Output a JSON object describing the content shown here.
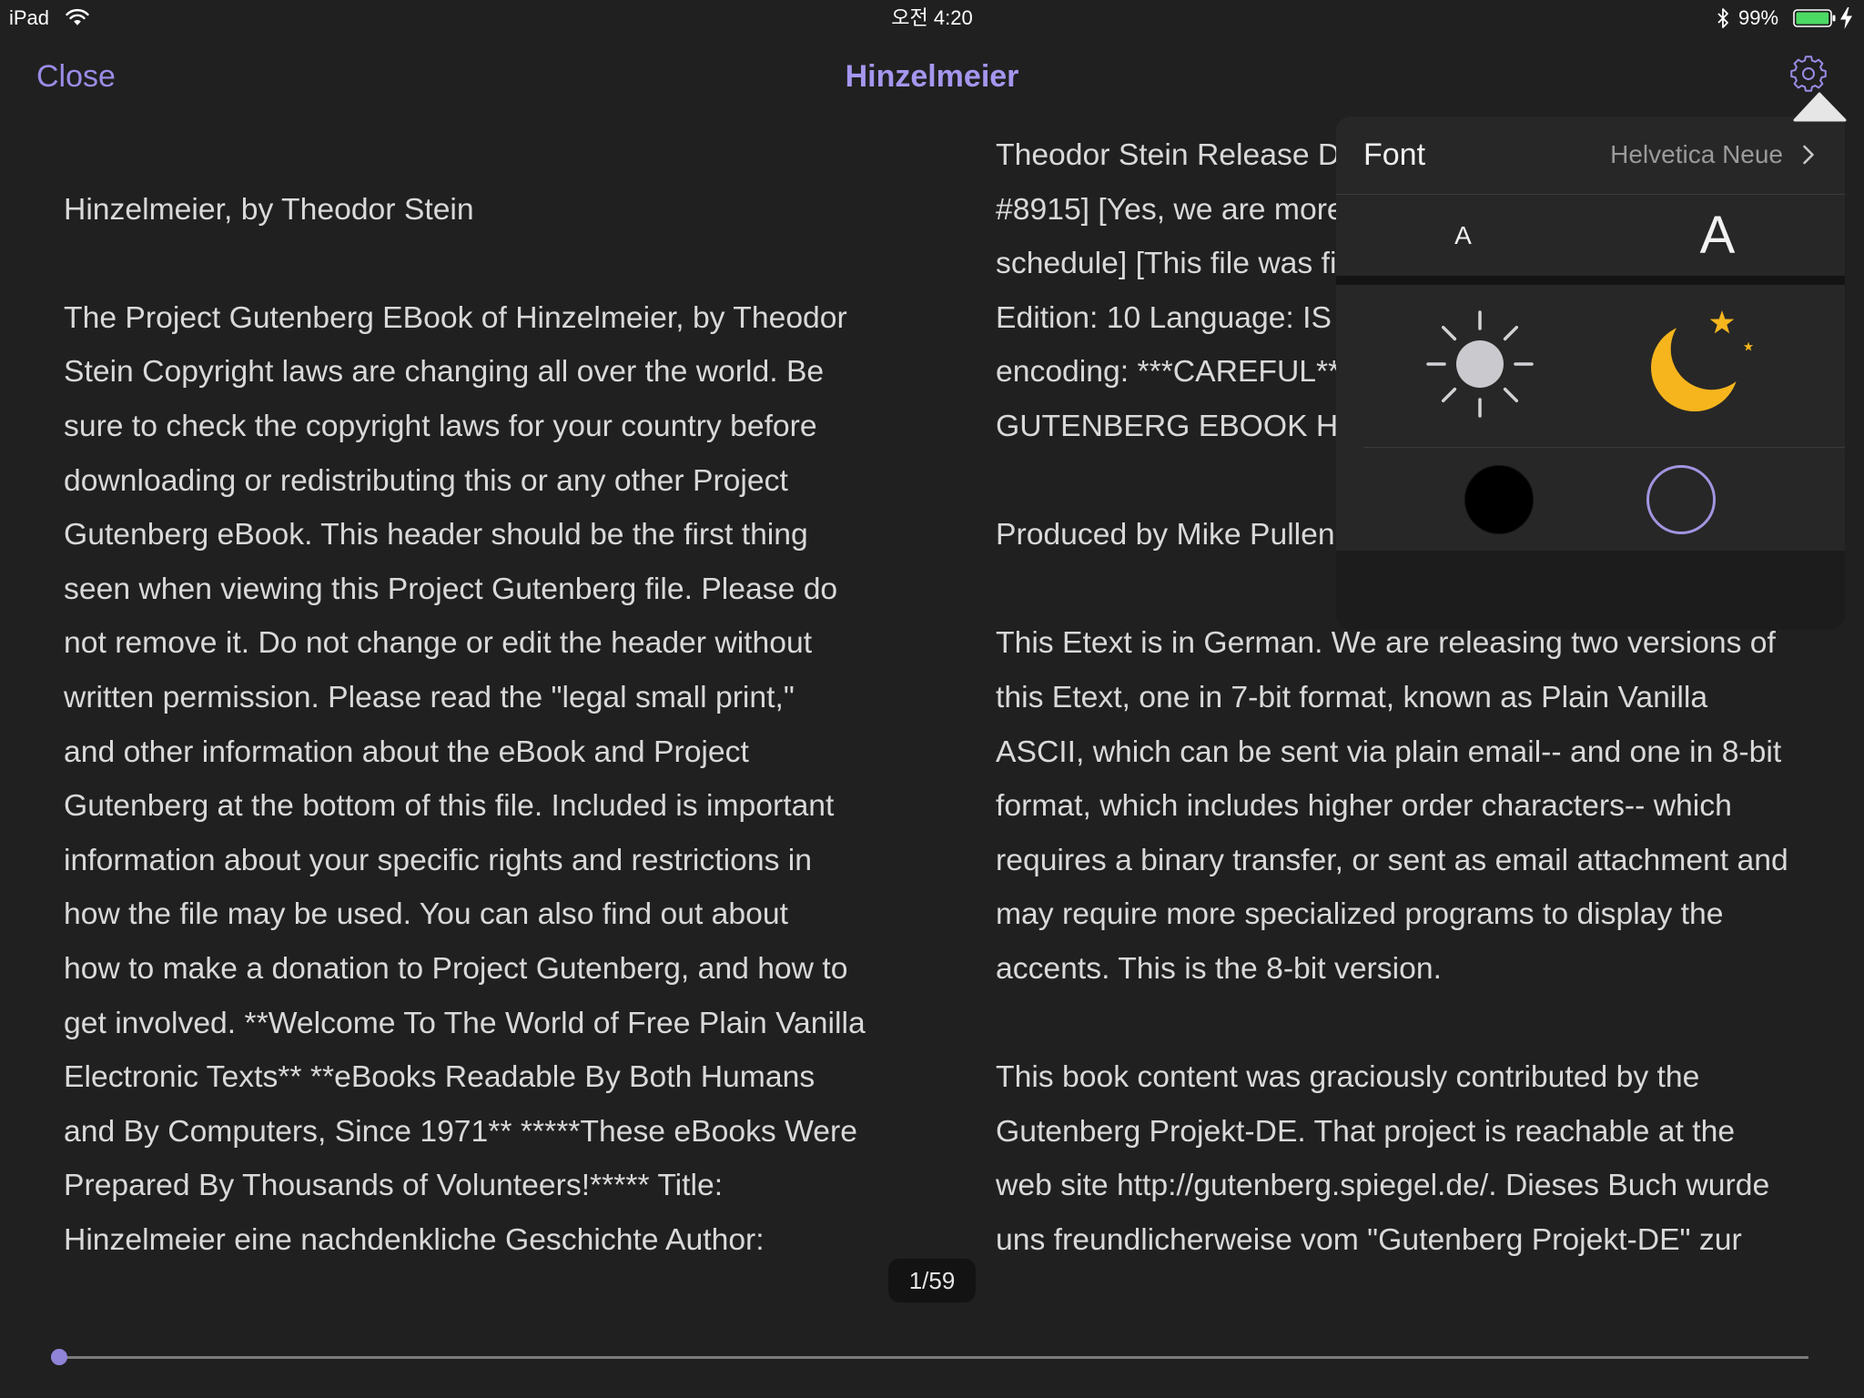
{
  "status_bar": {
    "device": "iPad",
    "time": "오전 4:20",
    "battery_label": "99%",
    "battery_level": 0.99,
    "icons": [
      "wifi-icon",
      "bluetooth-icon",
      "battery-icon",
      "charging-bolt-icon"
    ]
  },
  "nav": {
    "close_label": "Close",
    "title": "Hinzelmeier",
    "settings_icon": "gear-icon"
  },
  "page": {
    "left_column_lines": [
      "",
      "Hinzelmeier, by Theodor Stein",
      "",
      "The Project Gutenberg EBook of Hinzelmeier, by Theodor",
      "Stein Copyright laws are changing all over the world. Be",
      "sure to check the copyright laws for your country before",
      "downloading or redistributing this or any other Project",
      "Gutenberg eBook. This header should be the first thing",
      "seen when viewing this Project Gutenberg file. Please do",
      "not remove it. Do not change or edit the header without",
      "written permission. Please read the \"legal small print,\"",
      "and other information about the eBook and Project",
      "Gutenberg at the bottom of this file. Included is important",
      "information about your specific rights and restrictions in",
      "how the file may be used. You can also find out about",
      "how to make a donation to Project Gutenberg, and how to",
      "get involved. **Welcome To The World of Free Plain Vanilla",
      "Electronic Texts** **eBooks Readable By Both Humans",
      "and By Computers, Since 1971** *****These eBooks Were",
      "Prepared By Thousands of Volunteers!***** Title:",
      "Hinzelmeier eine nachdenkliche Geschichte Author:"
    ],
    "right_column_lines": [
      "Theodor Stein Release D",
      "#8915] [Yes, we are more",
      "schedule] [This file was fi",
      "Edition: 10 Language: IS",
      "encoding: ***CAREFUL**",
      "GUTENBERG EBOOK HI",
      "",
      "Produced by Mike Pullen",
      "",
      "This Etext is in German. We are releasing two versions of",
      "this Etext, one in 7-bit format, known as Plain Vanilla",
      "ASCII, which can be sent via plain email-- and one in 8-bit",
      "format, which includes higher order characters-- which",
      "requires a binary transfer, or sent as email attachment and",
      "may require more specialized programs to display the",
      "accents. This is the 8-bit version.",
      "",
      "This book content was graciously contributed by the",
      "Gutenberg Projekt-DE. That project is reachable at the",
      "web site http://gutenberg.spiegel.de/. Dieses Buch wurde",
      "uns freundlicherweise vom \"Gutenberg Projekt-DE\" zur"
    ]
  },
  "settings_popover": {
    "font_label": "Font",
    "font_value": "Helvetica Neue",
    "chevron_icon": "chevron-right-icon",
    "smaller_font_label": "A",
    "larger_font_label": "A",
    "theme_icons": [
      "sun-icon",
      "moon-icon"
    ],
    "swatch_colors": [
      "#000000",
      "#a394e0"
    ]
  },
  "pager": {
    "label": "1/59",
    "progress": 0
  },
  "colors": {
    "background": "#202020",
    "text": "#d9d9d9",
    "accent": "#9a8ce6",
    "title": "#a596ee",
    "popover": "#272727",
    "moon": "#f6b51d",
    "sun": "#c9c9ce",
    "battery": "#4cd964"
  }
}
